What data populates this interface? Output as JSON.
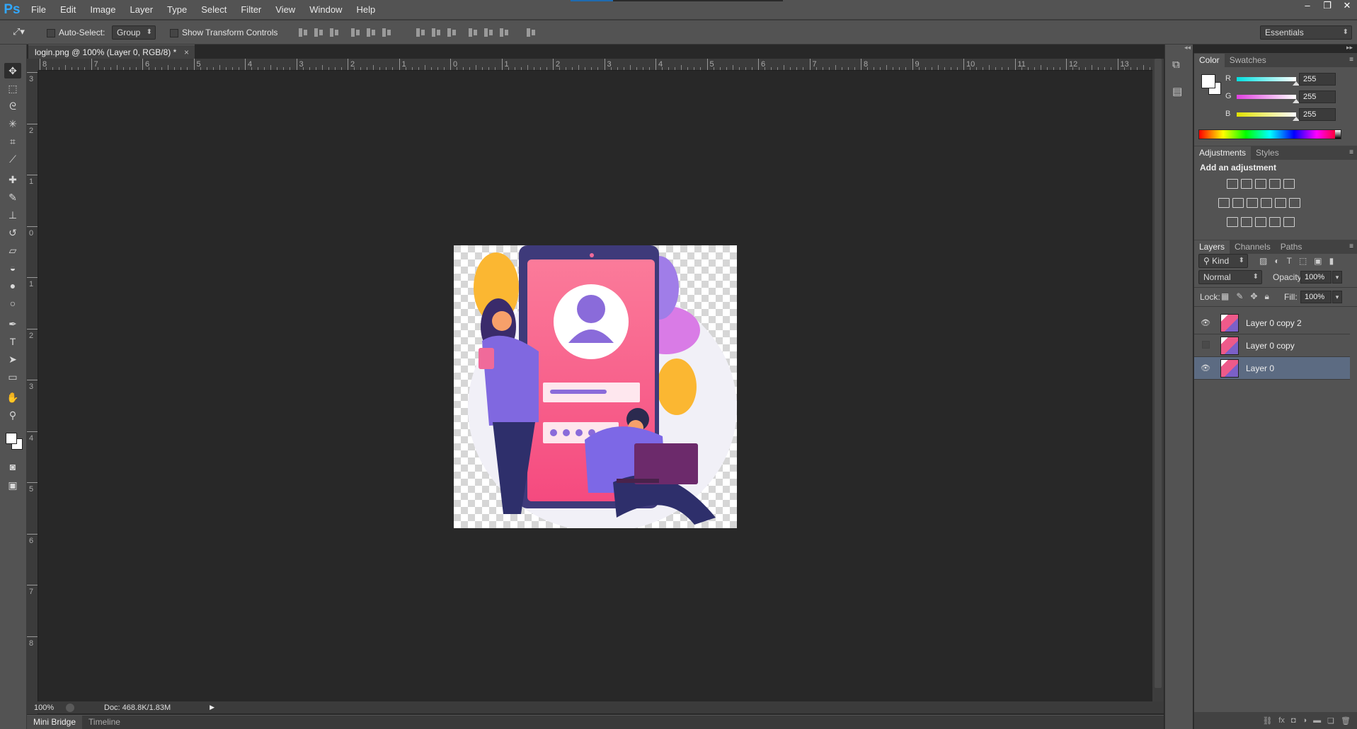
{
  "app": {
    "logo": "Ps"
  },
  "menu": [
    "File",
    "Edit",
    "Image",
    "Layer",
    "Type",
    "Select",
    "Filter",
    "View",
    "Window",
    "Help"
  ],
  "window_controls": [
    "–",
    "❐",
    "✕"
  ],
  "options": {
    "auto_select_label": "Auto-Select:",
    "auto_select_value": "Group",
    "transform_label": "Show Transform Controls",
    "workspace": "Essentials"
  },
  "document": {
    "tab_title": "login.png @ 100% (Layer 0, RGB/8) *",
    "close": "×"
  },
  "ruler": {
    "top_ticks": [
      "8",
      "7",
      "6",
      "5",
      "4",
      "3",
      "2",
      "1",
      "0",
      "1",
      "2",
      "3",
      "4",
      "5",
      "6",
      "7",
      "8",
      "9",
      "10",
      "11",
      "12",
      "13"
    ],
    "left_ticks": [
      "3",
      "2",
      "1",
      "0",
      "1",
      "2",
      "3",
      "4",
      "5",
      "6",
      "7",
      "8"
    ]
  },
  "status": {
    "zoom": "100%",
    "doc": "Doc: 468.8K/1.83M"
  },
  "bottom_tabs": [
    "Mini Bridge",
    "Timeline"
  ],
  "color_panel": {
    "tabs": [
      "Color",
      "Swatches"
    ],
    "channels": [
      {
        "label": "R",
        "value": "255",
        "color": "#00e0e0"
      },
      {
        "label": "G",
        "value": "255",
        "color": "#e040e0"
      },
      {
        "label": "B",
        "value": "255",
        "color": "#e0e000"
      }
    ]
  },
  "adjustments_panel": {
    "tabs": [
      "Adjustments",
      "Styles"
    ],
    "heading": "Add an adjustment"
  },
  "layers_panel": {
    "tabs": [
      "Layers",
      "Channels",
      "Paths"
    ],
    "kind_filter": "Kind",
    "blend_mode": "Normal",
    "opacity_label": "Opacity:",
    "opacity": "100%",
    "lock_label": "Lock:",
    "fill_label": "Fill:",
    "fill": "100%",
    "layers": [
      {
        "name": "Layer 0 copy 2",
        "visible": true,
        "selected": false
      },
      {
        "name": "Layer 0 copy",
        "visible": false,
        "selected": false
      },
      {
        "name": "Layer 0",
        "visible": true,
        "selected": true
      }
    ]
  },
  "colors": {
    "accent": "#31a8ff",
    "selected_layer": "#5c6b82",
    "canvas_bg": "#282828",
    "panel_bg": "#535353"
  }
}
